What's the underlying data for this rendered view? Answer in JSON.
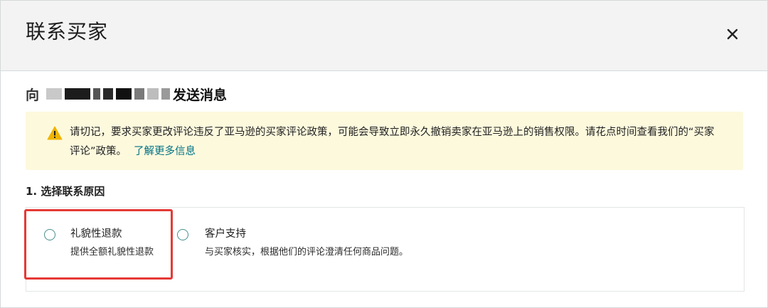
{
  "modal": {
    "title": "联系买家",
    "close_label": "×"
  },
  "recipient": {
    "prefix": "向",
    "suffix": "发送消息"
  },
  "alert": {
    "icon": "warning-icon",
    "text": "请切记，要求买家更改评论违反了亚马逊的买家评论政策，可能会导致立即永久撤销卖家在亚马逊上的销售权限。请花点时间查看我们的“买家评论”政策。",
    "link": "了解更多信息",
    "colors": {
      "background": "#fdf9dd",
      "icon": "#f0b400",
      "link": "#007185"
    }
  },
  "step": {
    "label": "1. 选择联系原因"
  },
  "options": [
    {
      "title": "礼貌性退款",
      "description": "提供全额礼貌性退款",
      "selected": false
    },
    {
      "title": "客户支持",
      "description": "与买家核实，根据他们的评论澄清任何商品问题。",
      "selected": false
    }
  ],
  "colors": {
    "highlight": "#e53935",
    "radio": "#4a8e8e",
    "header_bg": "#f3f3f3"
  }
}
